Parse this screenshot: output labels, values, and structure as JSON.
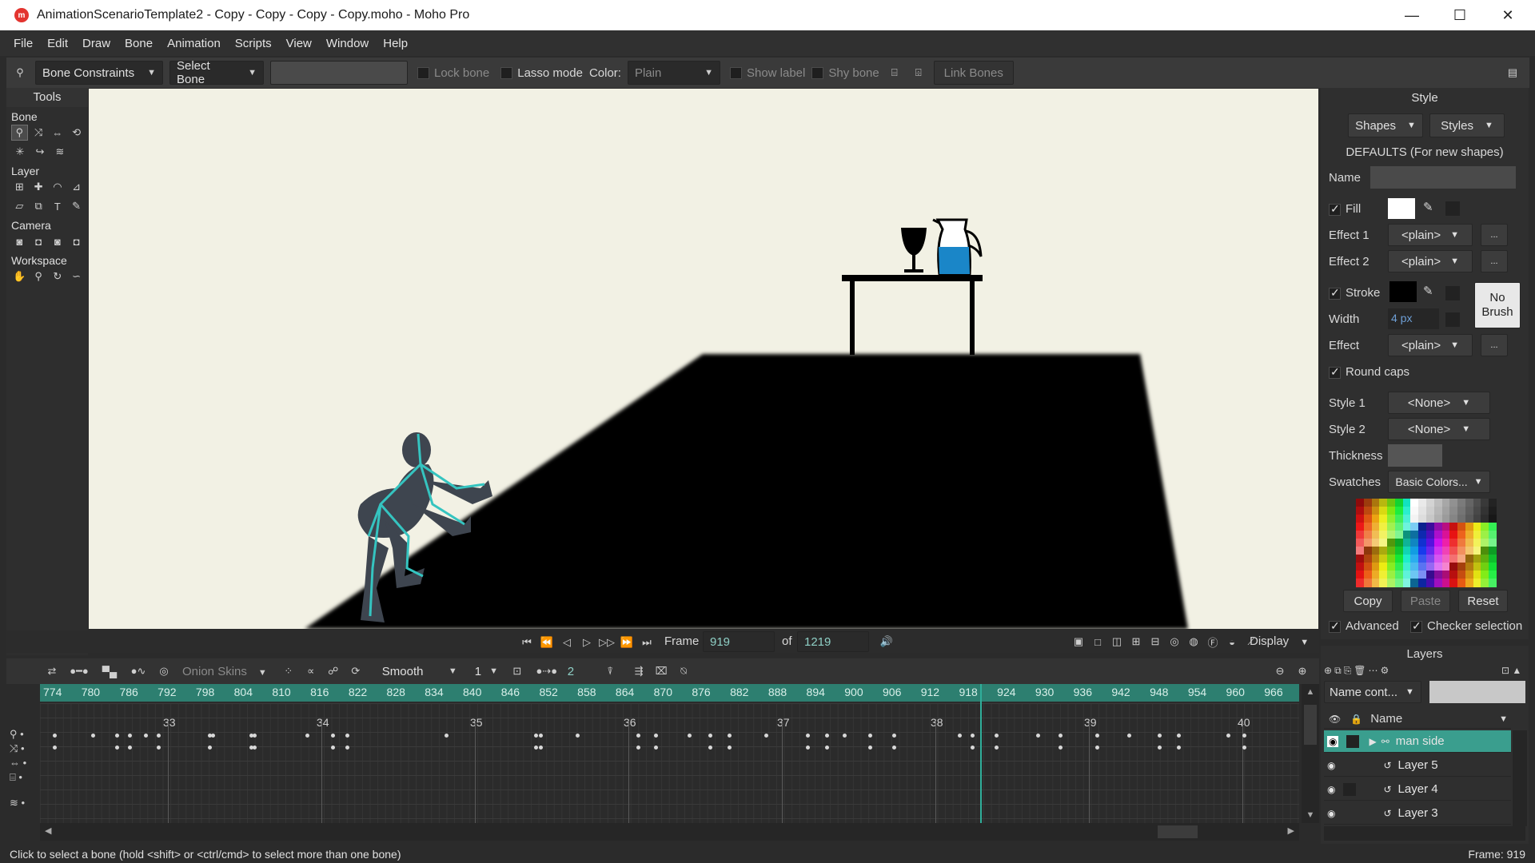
{
  "window": {
    "title": "AnimationScenarioTemplate2 - Copy - Copy - Copy - Copy.moho - Moho Pro",
    "minimize": "—",
    "maximize": "☐",
    "close": "✕"
  },
  "menu": [
    "File",
    "Edit",
    "Draw",
    "Bone",
    "Animation",
    "Scripts",
    "View",
    "Window",
    "Help"
  ],
  "toolbar": {
    "bone_constraints": "Bone Constraints",
    "select_bone": "Select Bone",
    "lock_bone": "Lock bone",
    "lasso_mode": "Lasso mode",
    "color_label": "Color:",
    "color_value": "Plain",
    "show_label": "Show label",
    "shy_bone": "Shy bone",
    "link_bones": "Link Bones"
  },
  "tools": {
    "title": "Tools",
    "sections": {
      "bone": "Bone",
      "layer": "Layer",
      "camera": "Camera",
      "workspace": "Workspace"
    }
  },
  "playback": {
    "frame_label": "Frame",
    "frame": "919",
    "of_label": "of",
    "total": "1219",
    "display": "Display"
  },
  "timeline": {
    "onion_skins": "Onion Skins",
    "interp": "Smooth",
    "step": "1",
    "skip": "2",
    "ruler": [
      "774",
      "780",
      "786",
      "792",
      "798",
      "804",
      "810",
      "816",
      "822",
      "828",
      "834",
      "840",
      "846",
      "852",
      "858",
      "864",
      "870",
      "876",
      "882",
      "888",
      "894",
      "900",
      "906",
      "912",
      "918",
      "924",
      "930",
      "936",
      "942",
      "948",
      "954",
      "960",
      "966"
    ],
    "seconds": [
      "33",
      "34",
      "35",
      "36",
      "37",
      "38",
      "39",
      "40"
    ]
  },
  "status": {
    "hint": "Click to select a bone (hold <shift> or <ctrl/cmd> to select more than one bone)",
    "frame": "Frame: 919"
  },
  "style": {
    "title": "Style",
    "shapes": "Shapes",
    "styles": "Styles",
    "defaults": "DEFAULTS (For new shapes)",
    "name_label": "Name",
    "fill": "Fill",
    "effect1": "Effect 1",
    "effect2": "Effect 2",
    "plain": "<plain>",
    "more": "...",
    "stroke": "Stroke",
    "width_label": "Width",
    "width_value": "4 px",
    "no_brush": "No Brush",
    "effect": "Effect",
    "round_caps": "Round caps",
    "style1": "Style 1",
    "style2": "Style 2",
    "none": "<None>",
    "thickness": "Thickness",
    "swatches": "Swatches",
    "swatch_set": "Basic Colors...",
    "copy": "Copy",
    "paste": "Paste",
    "reset": "Reset",
    "advanced": "Advanced",
    "checker": "Checker selection"
  },
  "layers": {
    "title": "Layers",
    "filter": "Name cont...",
    "name_col": "Name",
    "rows": [
      "man side",
      "Layer 5",
      "Layer 4",
      "Layer 3"
    ]
  },
  "colors": {
    "accent": "#2d7f70",
    "selected_layer": "#3a9e8e",
    "jug_water": "#1a86c8",
    "bone": "#35c4c0"
  }
}
